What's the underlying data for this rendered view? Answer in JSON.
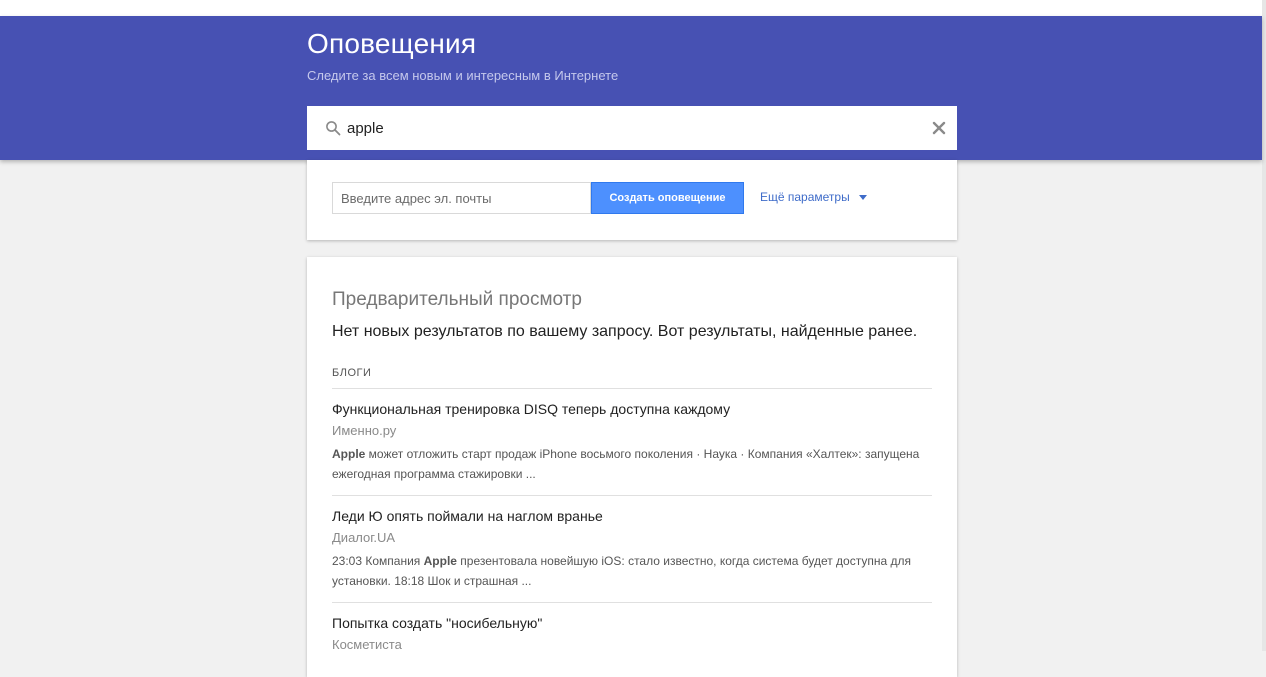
{
  "header": {
    "title": "Оповещения",
    "subtitle": "Следите за всем новым и интересным в Интернете"
  },
  "search": {
    "value": "apple",
    "icon": "search-icon",
    "clear_icon": "close-icon"
  },
  "create": {
    "email_placeholder": "Введите адрес эл. почты",
    "create_button_label": "Создать оповещение",
    "more_options_label": "Ещё параметры",
    "more_options_icon": "caret-down-icon"
  },
  "preview": {
    "title": "Предварительный просмотр",
    "message": "Нет новых результатов по вашему запросу. Вот результаты, найденные ранее.",
    "section_label": "БЛОГИ",
    "results": [
      {
        "title": "Функциональная тренировка DISQ теперь доступна каждому",
        "source": "Именно.ру",
        "snippet_prefix": "",
        "snippet_bold": "Apple",
        "snippet_rest": " может отложить старт продаж iPhone восьмого поколения · Наука · Компания «Халтек»: запущена ежегодная программа стажировки ..."
      },
      {
        "title": "Леди Ю опять поймали на наглом вранье",
        "source": "Диалог.UA",
        "snippet_prefix": "23:03 Компания ",
        "snippet_bold": "Apple",
        "snippet_rest": " презентовала новейшую iOS: стало известно, когда система будет доступна для установки. 18:18 Шок и страшная ..."
      },
      {
        "title": "Попытка создать \"носибельную\"",
        "source": "Косметиста",
        "snippet_prefix": "",
        "snippet_bold": "",
        "snippet_rest": ""
      }
    ]
  },
  "colors": {
    "header_bg": "#4751b3",
    "button_bg": "#4d90fe",
    "link": "#3f6cc9"
  }
}
